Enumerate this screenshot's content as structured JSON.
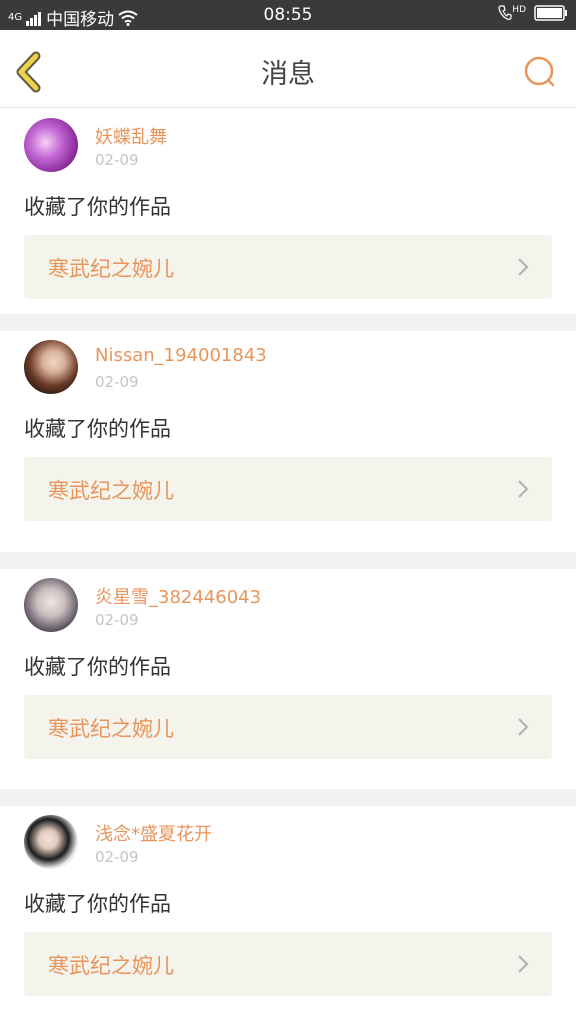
{
  "status_bar": {
    "network": "4G",
    "carrier": "中国移动",
    "time": "08:55",
    "hd_label": "HD"
  },
  "header": {
    "title": "消息",
    "back_icon": "chevron-left-icon",
    "search_icon": "search-icon"
  },
  "notifications": [
    {
      "username": "妖蝶乱舞",
      "date": "02-09",
      "action": "收藏了你的作品",
      "work_title": "寒武纪之婉儿"
    },
    {
      "username": "Nissan_194001843",
      "date": "02-09",
      "action": "收藏了你的作品",
      "work_title": "寒武纪之婉儿"
    },
    {
      "username": "炎星雪_382446043",
      "date": "02-09",
      "action": "收藏了你的作品",
      "work_title": "寒武纪之婉儿"
    },
    {
      "username": "浅念*盛夏花开",
      "date": "02-09",
      "action": "收藏了你的作品",
      "work_title": "寒武纪之婉儿"
    }
  ],
  "colors": {
    "accent": "#e8955c",
    "back_icon_fill": "#f0d24a",
    "card_bg": "#f4f3ec",
    "separator": "#f2f2f2"
  }
}
